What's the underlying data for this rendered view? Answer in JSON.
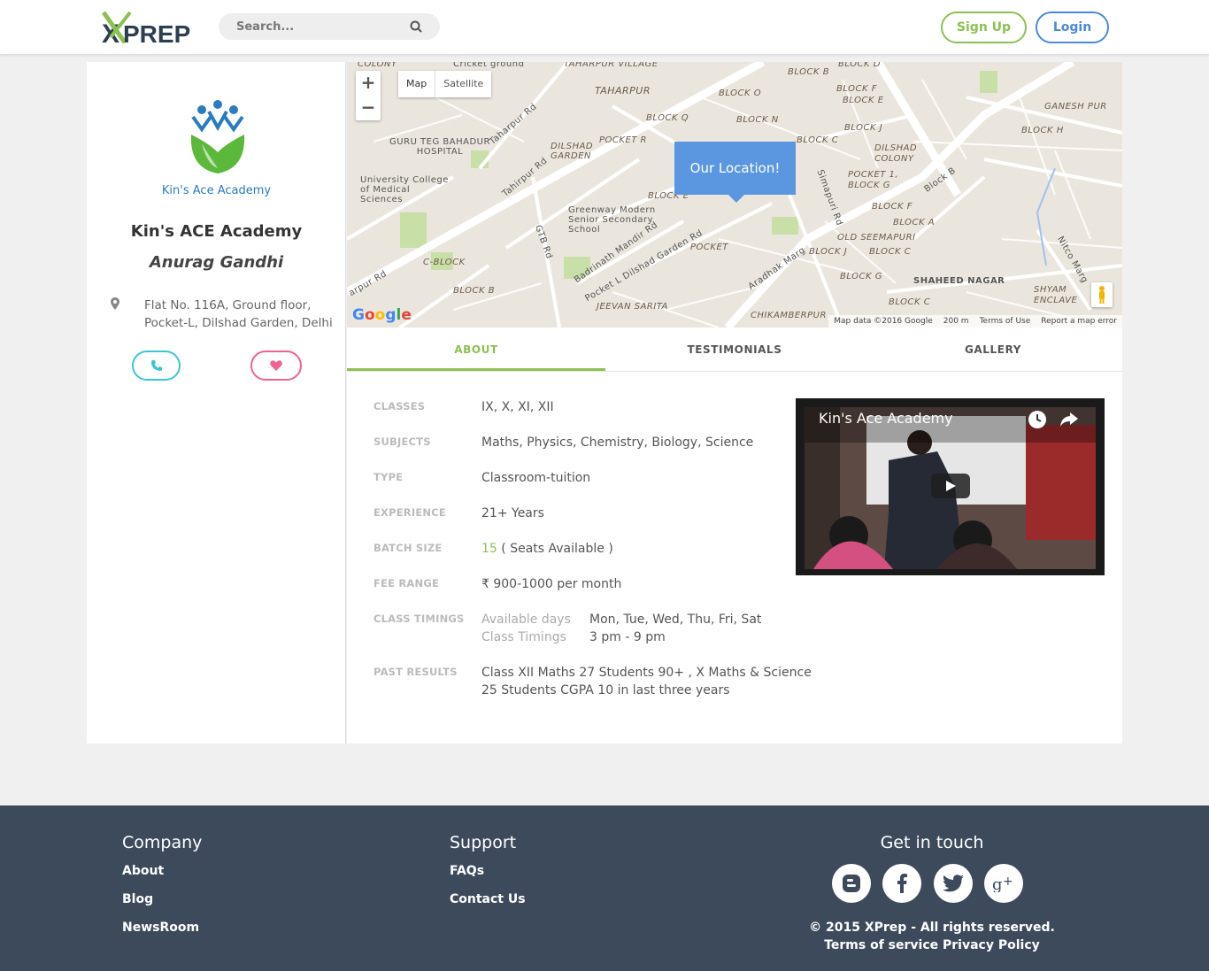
{
  "header": {
    "logo_text": "XPREP",
    "search_placeholder": "Search...",
    "signup_label": "Sign Up",
    "login_label": "Login",
    "brand_green": "#8cc152",
    "brand_blue": "#4a89dc"
  },
  "profile": {
    "logo_caption": "Kin's Ace Academy",
    "name": "Kin's ACE Academy",
    "owner": "Anurag Gandhi",
    "address_line1": "Flat No. 116A, Ground floor,",
    "address_line2": "Pocket-L, Dilshad Garden, Delhi"
  },
  "map": {
    "zoom_in": "+",
    "zoom_out": "−",
    "type_map": "Map",
    "type_satellite": "Satellite",
    "bubble": "Our Location!",
    "google": "Google",
    "footer_data": "Map data ©2016 Google",
    "footer_scale": "200 m",
    "footer_terms": "Terms of Use",
    "footer_report": "Report a map error",
    "labels": [
      "COLONY",
      "Cricket ground",
      "TAHARPUR VILLAGE",
      "TAHARPUR",
      "Taharpur Rd",
      "GURU TEG BAHADUR HOSPITAL",
      "University College of Medical Sciences",
      "DILSHAD GARDEN",
      "POCKET R",
      "BLOCK Q",
      "BLOCK O",
      "BLOCK B",
      "BLOCK D",
      "BLOCK F",
      "BLOCK E",
      "BLOCK N",
      "BLOCK J",
      "BLOCK C",
      "GANESH PUR",
      "BLOCK H",
      "DILSHAD COLONY",
      "POCKET 1, BLOCK G",
      "Block B",
      "Tahirpur Rd",
      "Greenway Modern Senior Secondary School",
      "BLOCK E",
      "GTB Rd",
      "Badrinath Mandir Rd",
      "Pocket L Dilshad Garden Rd",
      "POCKET",
      "Aradhak Marg",
      "Simapuri Rd",
      "BLOCK F",
      "BLOCK A",
      "OLD SEEMAPURI",
      "BLOCK J",
      "BLOCK C",
      "BLOCK G",
      "SHAHEED NAGAR",
      "SHYAM ENCLAVE",
      "Nitco Marg",
      "C-BLOCK",
      "BLOCK B",
      "JEEVAN SARITA",
      "CHIKAMBERPUR",
      "BLOCK C",
      "arpur Rd"
    ]
  },
  "tabs": [
    "ABOUT",
    "TESTIMONIALS",
    "GALLERY"
  ],
  "details": {
    "classes_label": "CLASSES",
    "classes": "IX, X, XI, XII",
    "subjects_label": "SUBJECTS",
    "subjects": "Maths, Physics, Chemistry, Biology, Science",
    "type_label": "TYPE",
    "type": "Classroom-tuition",
    "experience_label": "EXPERIENCE",
    "experience": "21+ Years",
    "batch_label": "BATCH SIZE",
    "batch_count": "15",
    "batch_note": "( Seats Available )",
    "fee_label": "FEE RANGE",
    "fee": "₹ 900-1000 per month",
    "timings_label": "CLASS TIMINGS",
    "days_label": "Available days",
    "days": "Mon, Tue, Wed, Thu, Fri, Sat",
    "timings_sub_label": "Class Timings",
    "timings": "3 pm - 9 pm",
    "results_label": "PAST RESULTS",
    "results_line1": "Class XII Maths 27 Students 90+ , X Maths & Science",
    "results_line2": "25 Students CGPA 10 in last three years"
  },
  "video": {
    "title": "Kin's Ace Academy"
  },
  "footer": {
    "company_title": "Company",
    "company_links": [
      "About",
      "Blog",
      "NewsRoom"
    ],
    "support_title": "Support",
    "support_links": [
      "FAQs",
      "Contact Us"
    ],
    "contact_title": "Get in touch",
    "social_icons": [
      "blogger-icon",
      "facebook-icon",
      "twitter-icon",
      "google-plus-icon"
    ],
    "copyright": "© 2015 XPrep - All rights reserved.",
    "terms": "Terms of service",
    "privacy": "Privacy Policy",
    "bg_color": "#3d4a5c"
  }
}
